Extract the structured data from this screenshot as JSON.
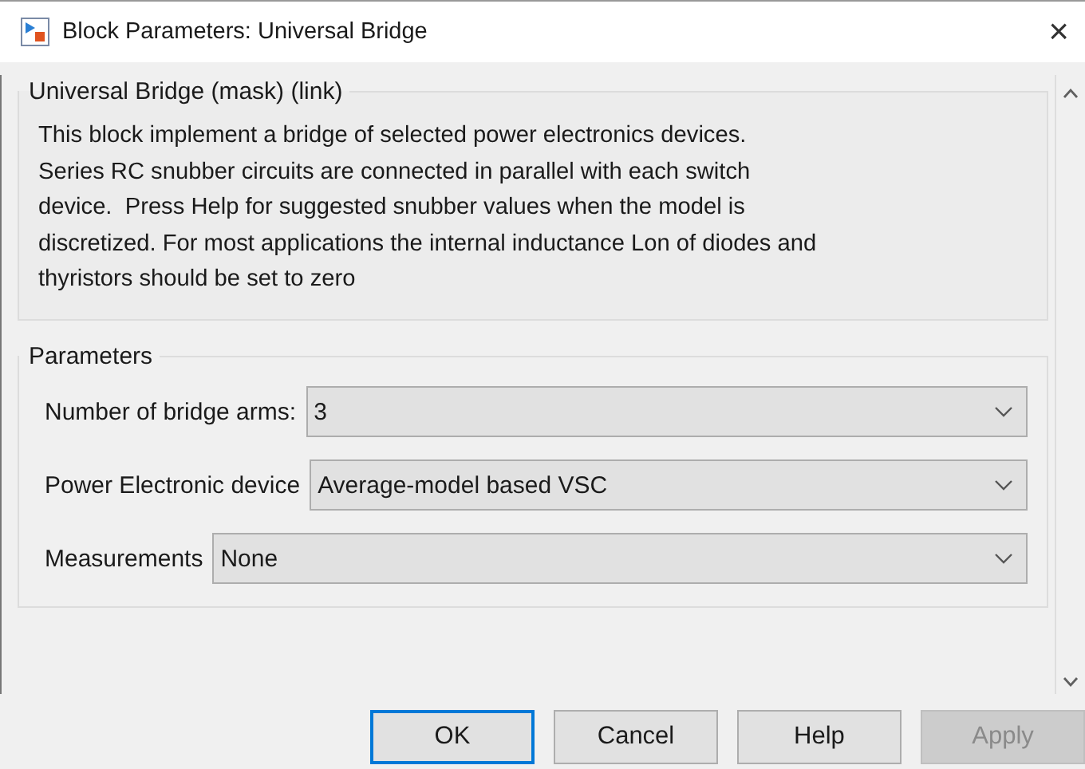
{
  "window": {
    "title": "Block Parameters: Universal Bridge",
    "close": "×"
  },
  "description": {
    "title": "Universal Bridge (mask) (link)",
    "lines": [
      "This block implement a bridge of selected power electronics devices.",
      "Series RC snubber circuits are connected in parallel with each switch",
      "device.  Press Help for suggested snubber values when the model is",
      "discretized. For most applications the internal inductance Lon of diodes and",
      "thyristors should be set to zero"
    ]
  },
  "parameters": {
    "title": "Parameters",
    "fields": [
      {
        "label": "Number of bridge arms:",
        "value": "3"
      },
      {
        "label": "Power Electronic device",
        "value": "Average-model based VSC"
      },
      {
        "label": "Measurements",
        "value": "None"
      }
    ]
  },
  "buttons": [
    {
      "label": "OK",
      "default": true,
      "disabled": false
    },
    {
      "label": "Cancel",
      "default": false,
      "disabled": false
    },
    {
      "label": "Help",
      "default": false,
      "disabled": false
    },
    {
      "label": "Apply",
      "default": false,
      "disabled": true
    }
  ]
}
